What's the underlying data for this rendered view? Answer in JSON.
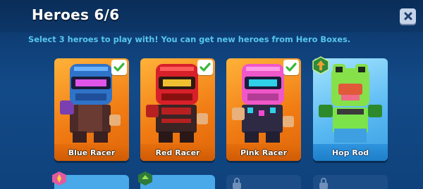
{
  "header": {
    "title": "Heroes 6/6",
    "close_icon": "close-icon"
  },
  "subtitle": "Select 3 heroes to play with! You can get new heroes from Hero Boxes.",
  "colors": {
    "selected_card": "#f07a12",
    "unselected_card": "#57b8f2",
    "subtitle_text": "#56c6ef",
    "check_mark": "#3cb83c"
  },
  "heroes": [
    {
      "name": "Blue Racer",
      "selected": true,
      "icon": "check-icon"
    },
    {
      "name": "Red Racer",
      "selected": true,
      "icon": "check-icon"
    },
    {
      "name": "Pink Racer",
      "selected": true,
      "icon": "check-icon"
    },
    {
      "name": "Hop Rod",
      "selected": false,
      "icon": "upgrade-arrow-icon"
    }
  ],
  "second_row_icons": [
    "fire-badge-icon",
    "green-badge-icon",
    "lock-icon",
    "lock-icon"
  ]
}
